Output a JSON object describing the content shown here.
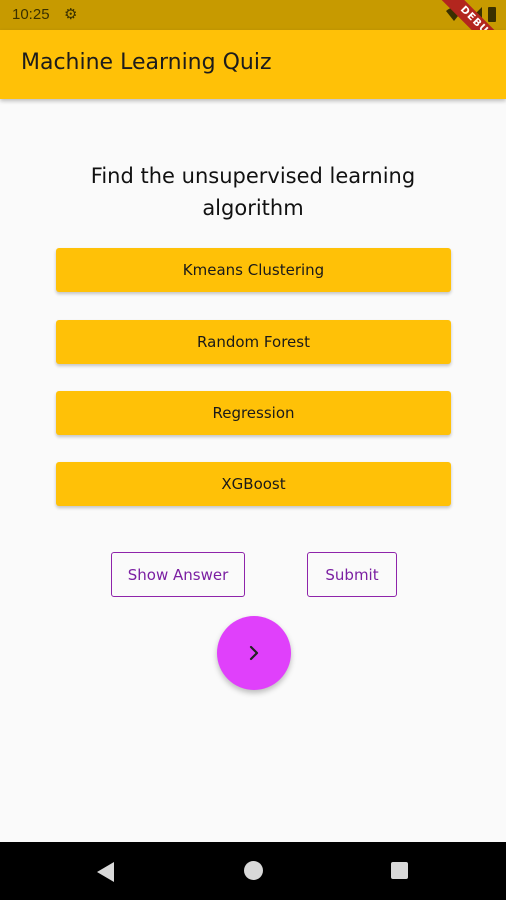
{
  "status_bar": {
    "time": "10:25",
    "icons": [
      "gear-icon",
      "wifi-icon",
      "signal-icon",
      "battery-icon"
    ],
    "debug_label": "DEBUG"
  },
  "app_bar": {
    "title": "Machine Learning Quiz"
  },
  "quiz": {
    "question": "Find the unsupervised learning algorithm",
    "options": [
      "Kmeans Clustering",
      "Random Forest",
      "Regression",
      "XGBoost"
    ]
  },
  "actions": {
    "show_answer": "Show Answer",
    "submit": "Submit",
    "next_icon": "chevron-right-icon"
  },
  "colors": {
    "accent": "#ffc107",
    "fab": "#e040fb",
    "outline": "#8e24aa"
  }
}
